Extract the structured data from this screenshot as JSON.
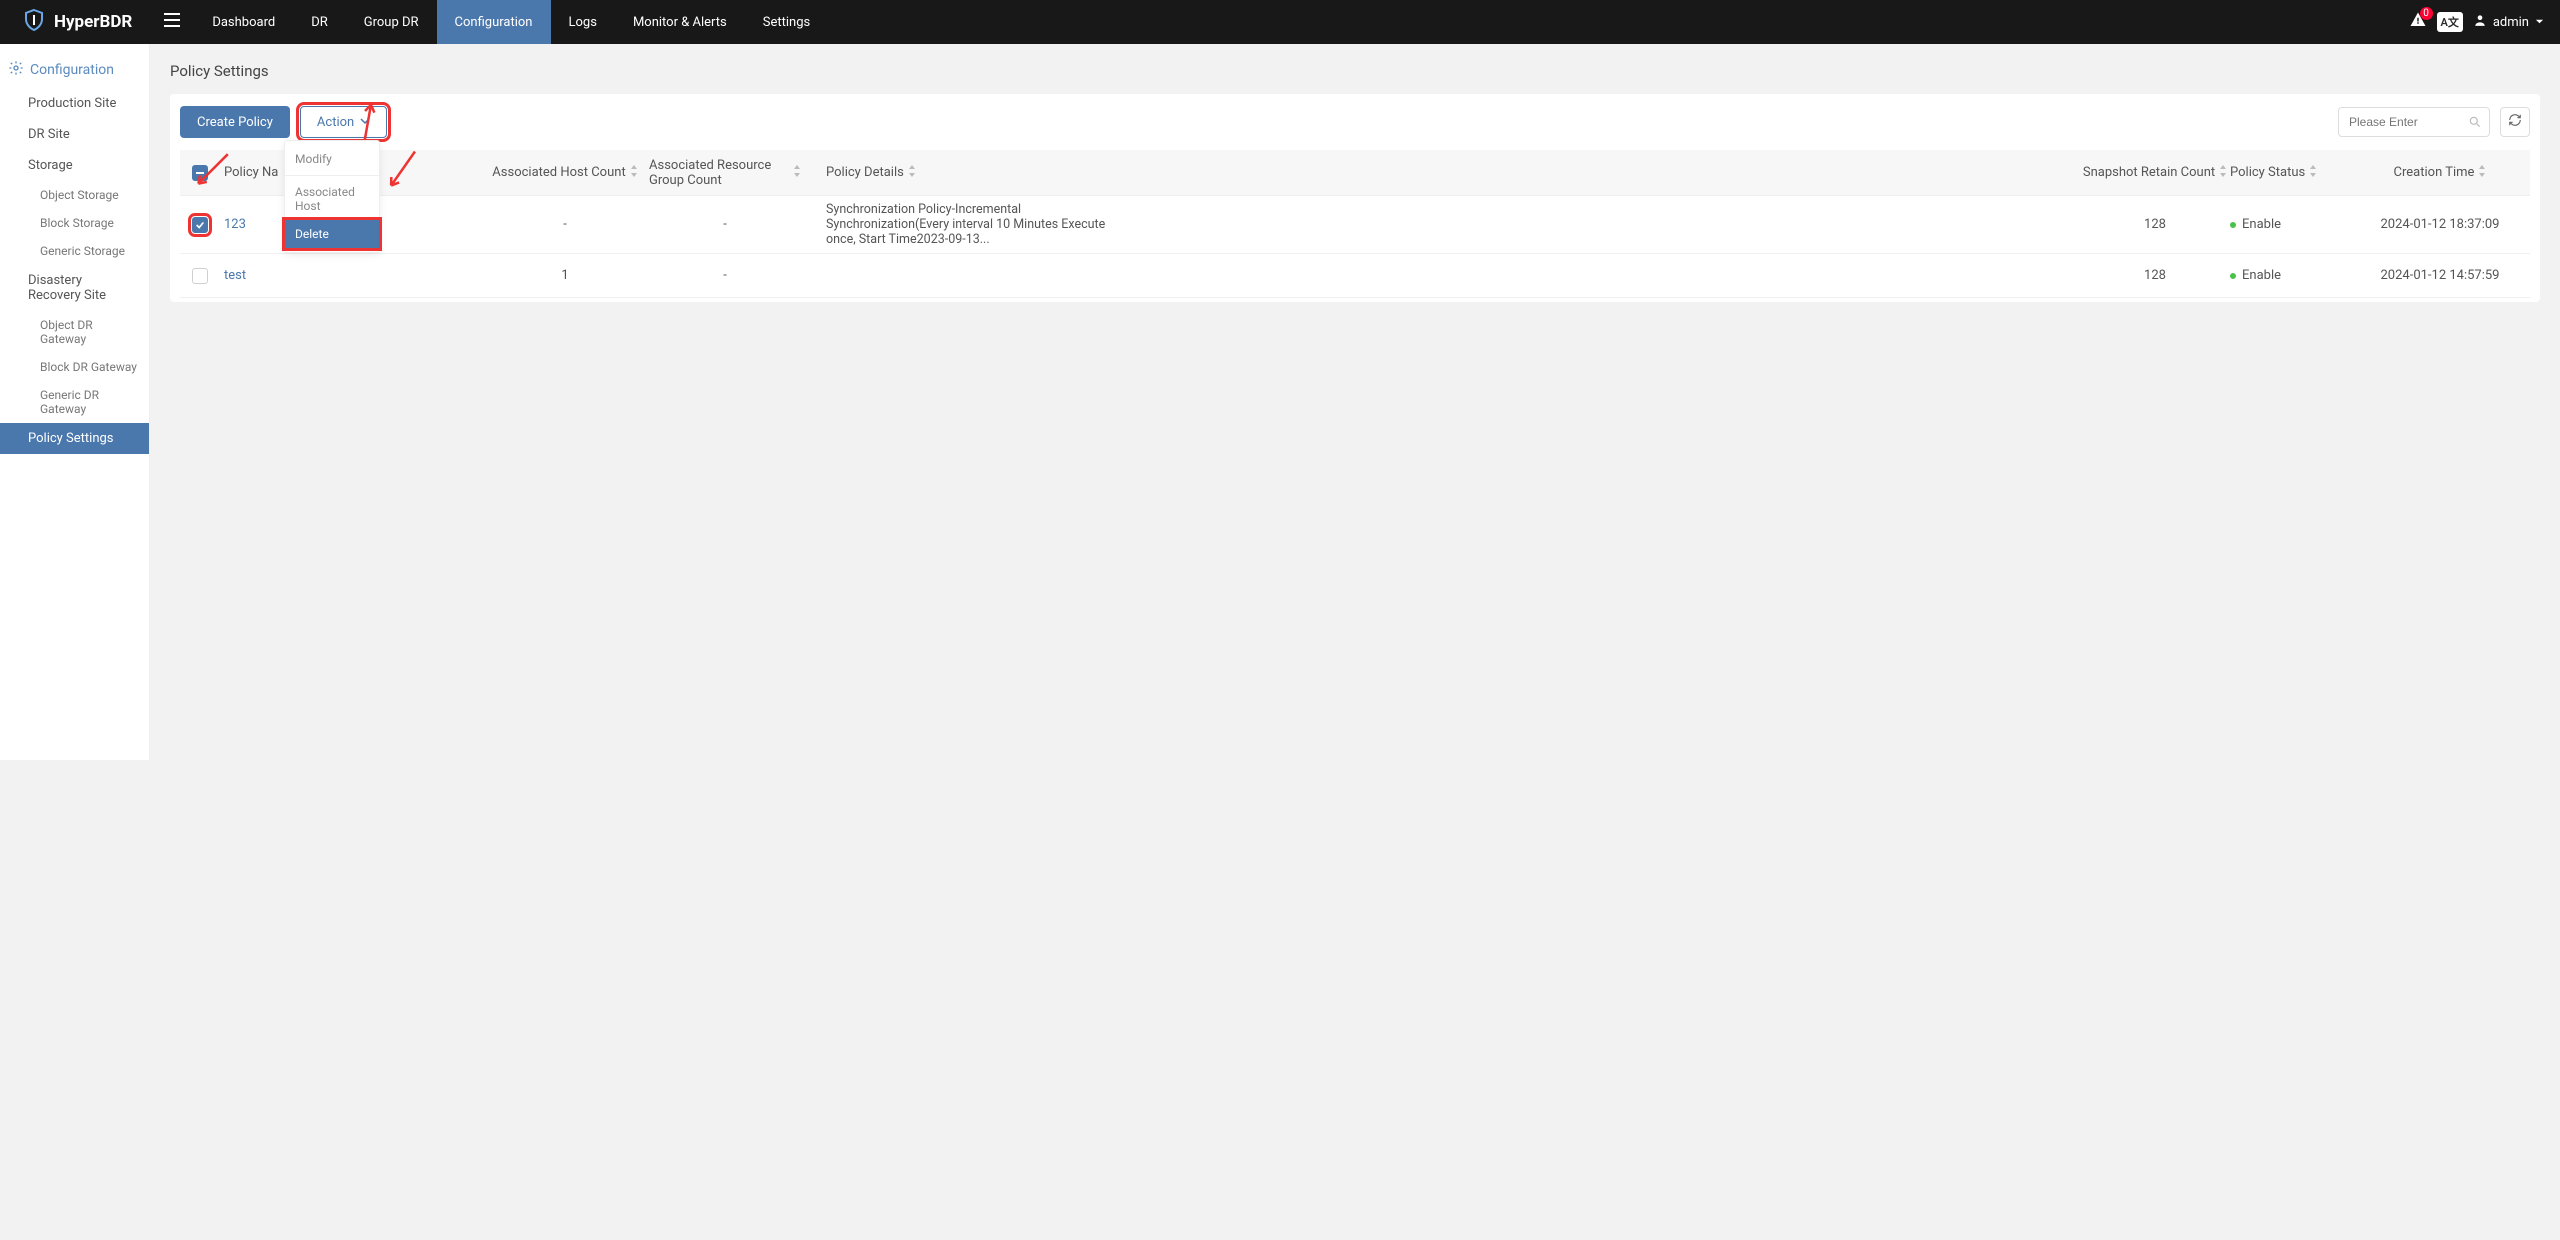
{
  "brand": "HyperBDR",
  "nav": {
    "items": [
      "Dashboard",
      "DR",
      "Group DR",
      "Configuration",
      "Logs",
      "Monitor & Alerts",
      "Settings"
    ],
    "active": "Configuration"
  },
  "topbar": {
    "alert_count": "0",
    "lang": "A文",
    "user": "admin"
  },
  "sidebar": {
    "header": "Configuration",
    "items": [
      {
        "label": "Production Site",
        "level": 1
      },
      {
        "label": "DR Site",
        "level": 1
      },
      {
        "label": "Storage",
        "level": 1
      },
      {
        "label": "Object Storage",
        "level": 2
      },
      {
        "label": "Block Storage",
        "level": 2
      },
      {
        "label": "Generic Storage",
        "level": 2
      },
      {
        "label": "Disastery Recovery Site",
        "level": 1
      },
      {
        "label": "Object DR Gateway",
        "level": 2
      },
      {
        "label": "Block DR Gateway",
        "level": 2
      },
      {
        "label": "Generic DR Gateway",
        "level": 2
      },
      {
        "label": "Policy Settings",
        "level": 1,
        "active": true
      }
    ]
  },
  "page_title": "Policy Settings",
  "toolbar": {
    "create_label": "Create Policy",
    "action_label": "Action",
    "search_placeholder": "Please Enter"
  },
  "dropdown": {
    "modify": "Modify",
    "associated": "Associated Host",
    "delete": "Delete"
  },
  "table": {
    "headers": {
      "name": "Policy Na",
      "host_count": "Associated Host Count",
      "res_group": "Associated Resource Group Count",
      "details": "Policy Details",
      "snap": "Snapshot Retain Count",
      "status": "Policy Status",
      "time": "Creation Time"
    },
    "rows": [
      {
        "checked": true,
        "name": "123",
        "host_count": "-",
        "res_group": "-",
        "details": "Synchronization Policy-Incremental Synchronization(Every interval 10 Minutes Execute once, Start Time2023-09-13...",
        "snap": "128",
        "status": "Enable",
        "time": "2024-01-12 18:37:09"
      },
      {
        "checked": false,
        "name": "test",
        "host_count": "1",
        "res_group": "-",
        "details": "",
        "snap": "128",
        "status": "Enable",
        "time": "2024-01-12 14:57:59"
      }
    ]
  },
  "colors": {
    "accent": "#4a77ac",
    "danger_outline": "#e33",
    "status_ok": "#4ac24a"
  }
}
